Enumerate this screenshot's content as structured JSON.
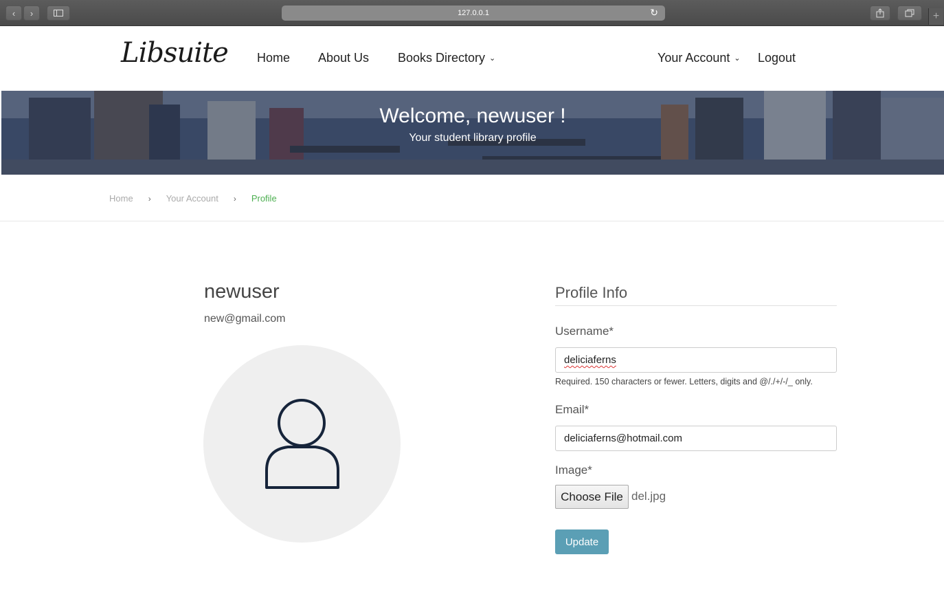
{
  "browser": {
    "url": "127.0.0.1",
    "back_icon": "chevron-left-icon",
    "forward_icon": "chevron-right-icon",
    "sidebar_icon": "sidebar-icon",
    "reload_icon": "reload-icon",
    "share_icon": "share-icon",
    "tabs_icon": "tabs-icon",
    "newtab_label": "+"
  },
  "nav": {
    "logo": "Libsuite",
    "home": "Home",
    "about": "About Us",
    "books": "Books Directory",
    "account": "Your Account",
    "logout": "Logout"
  },
  "hero": {
    "title": "Welcome, newuser !",
    "subtitle": "Your student library profile"
  },
  "breadcrumb": {
    "items": [
      "Home",
      "Your Account",
      "Profile"
    ],
    "separator": "›"
  },
  "profile": {
    "username": "newuser",
    "email": "new@gmail.com",
    "avatar_icon": "user-icon"
  },
  "form": {
    "title": "Profile Info",
    "username_label": "Username*",
    "username_value": "deliciaferns",
    "username_help": "Required. 150 characters or fewer. Letters, digits and @/./+/-/_ only.",
    "email_label": "Email*",
    "email_value": "deliciaferns@hotmail.com",
    "image_label": "Image*",
    "file_button": "Choose File",
    "file_name": "del.jpg",
    "submit": "Update"
  },
  "colors": {
    "accent_green": "#4caf50",
    "button_blue": "#5b9fb5",
    "hero_overlay": "#2c3a5a"
  }
}
